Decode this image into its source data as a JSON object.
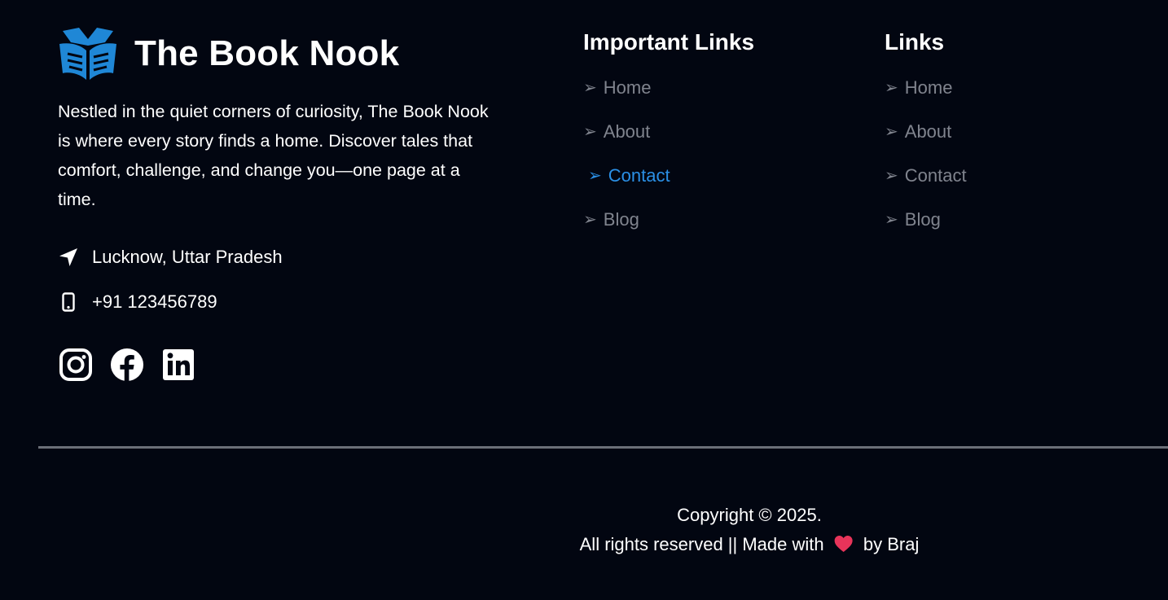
{
  "brand": {
    "name": "The Book Nook",
    "logo_icon": "open-book-reader-icon",
    "logo_color": "#1f87d6"
  },
  "about": {
    "text": "Nestled in the quiet corners of curiosity, The Book Nook is where every story finds a home. Discover tales that comfort, challenge, and change you—one page at a time."
  },
  "contact": {
    "location": "Lucknow, Uttar Pradesh",
    "location_icon": "location-arrow-icon",
    "phone": "+91 123456789",
    "phone_icon": "mobile-phone-icon"
  },
  "socials": [
    {
      "name": "instagram",
      "icon": "instagram-icon"
    },
    {
      "name": "facebook",
      "icon": "facebook-icon"
    },
    {
      "name": "linkedin",
      "icon": "linkedin-icon"
    }
  ],
  "important_links": {
    "title": "Important Links",
    "arrow": "➢",
    "items": [
      {
        "label": "Home",
        "active": false
      },
      {
        "label": "About",
        "active": false
      },
      {
        "label": "Contact",
        "active": true
      },
      {
        "label": "Blog",
        "active": false
      }
    ]
  },
  "links": {
    "title": "Links",
    "arrow": "➢",
    "items": [
      {
        "label": "Home"
      },
      {
        "label": "About"
      },
      {
        "label": "Contact"
      },
      {
        "label": "Blog"
      }
    ]
  },
  "footer": {
    "copyright_line": "Copyright © 2025.",
    "rights_prefix": "All rights reserved || Made with",
    "rights_suffix": "by Braj",
    "heart_icon": "heart-icon"
  },
  "colors": {
    "background": "#020611",
    "link_muted": "#80848e",
    "link_active": "#2b90e6",
    "heart": "#e8345a",
    "divider": "#6b6f78"
  }
}
